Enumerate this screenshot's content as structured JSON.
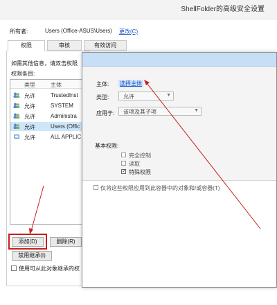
{
  "window": {
    "title": "ShellFolder的高级安全设置"
  },
  "owner": {
    "label": "所有者:",
    "value": "Users (Office-ASUS\\Users)",
    "change_link": "更改(C)"
  },
  "tabs": [
    {
      "label": "权限"
    },
    {
      "label": "审核"
    },
    {
      "label": "有效访问"
    }
  ],
  "permissions": {
    "hint": "如需其他信息，请双击权限",
    "entries_label": "权限条目:",
    "columns": {
      "type": "类型",
      "principal": "主体"
    },
    "rows": [
      {
        "type": "允许",
        "principal": "TrustedInst"
      },
      {
        "type": "允许",
        "principal": "SYSTEM"
      },
      {
        "type": "允许",
        "principal": "Administra"
      },
      {
        "type": "允许",
        "principal": "Users (Offic"
      },
      {
        "type": "允许",
        "principal": "ALL APPLIC"
      }
    ],
    "add_button": "添加(D)",
    "remove_button": "删除(R)",
    "disable_inheritance_button": "禁用继承(I)",
    "replace_checkbox_label": "使用可从此对象继承的权"
  },
  "entry_dialog": {
    "principal_label": "主体:",
    "principal_link": "选择主体",
    "type_label": "类型:",
    "type_value": "允许",
    "applies_label": "应用于:",
    "applies_value": "该项及其子项",
    "basic_permissions_label": "基本权限:",
    "checkboxes": {
      "full_control": "完全控制",
      "read": "读取",
      "special": "特殊权限"
    },
    "apply_only_label": "仅将这些权限应用到此容器中的对象和/或容器(T)"
  },
  "colors": {
    "arrow": "#c81e1e",
    "link": "#1a56c8",
    "selection": "#cde6fa"
  }
}
